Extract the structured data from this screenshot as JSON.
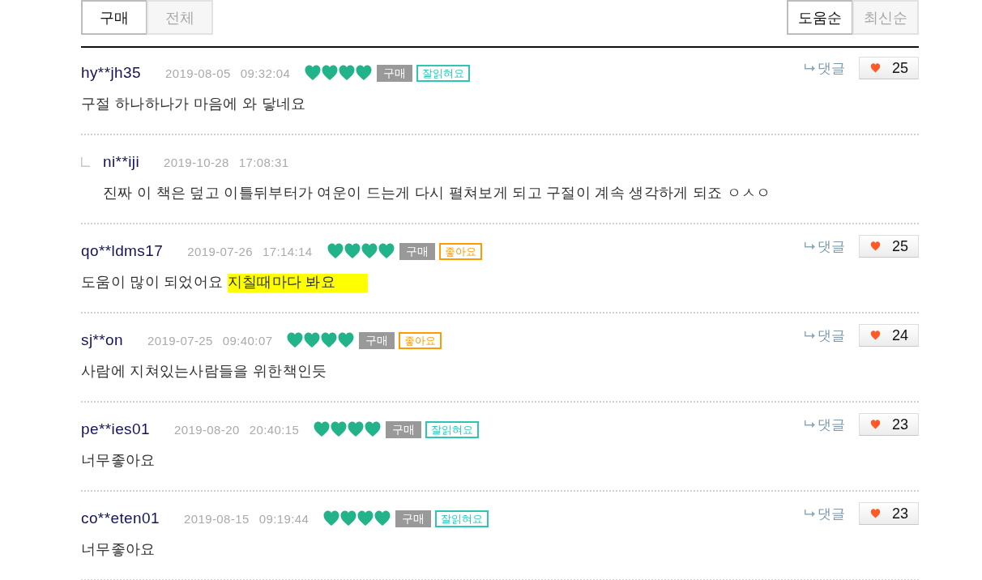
{
  "filter_tabs": [
    {
      "label": "구매",
      "selected": true
    },
    {
      "label": "전체",
      "selected": false
    }
  ],
  "sort_tabs": [
    {
      "label": "도움순",
      "selected": true
    },
    {
      "label": "최신순",
      "selected": false
    }
  ],
  "reviews": [
    {
      "user": "hy**jh35",
      "date": "2019-08-05",
      "time": "09:32:04",
      "stars": 4,
      "badge": "구매",
      "tag": {
        "label": "잘읽혀요",
        "color": "#2ec4b6"
      },
      "text": "구절 하나하나가 마음에 와 닿네요",
      "reply_link": "댓글",
      "likes": "25",
      "replies": [
        {
          "user": "ni**iji",
          "date": "2019-10-28",
          "time": "17:08:31",
          "text": "진짜 이 책은 덮고 이틀뒤부터가 여운이 드는게 다시 펼쳐보게 되고 구절이 계속 생각하게 되죠 ㅇㅅㅇ"
        }
      ]
    },
    {
      "user": "qo**ldms17",
      "date": "2019-07-26",
      "time": "17:14:14",
      "stars": 4,
      "badge": "구매",
      "tag": {
        "label": "좋아요",
        "color": "#ff9a00"
      },
      "text": "도움이 많이 되었어요",
      "highlight": "지칠때마다 봐요",
      "reply_link": "댓글",
      "likes": "25"
    },
    {
      "user": "sj**on",
      "date": "2019-07-25",
      "time": "09:40:07",
      "stars": 4,
      "badge": "구매",
      "tag": {
        "label": "좋아요",
        "color": "#ff9a00"
      },
      "text": "사람에 지쳐있는사람들을 위한책인듯",
      "reply_link": "댓글",
      "likes": "24"
    },
    {
      "user": "pe**ies01",
      "date": "2019-08-20",
      "time": "20:40:15",
      "stars": 4,
      "badge": "구매",
      "tag": {
        "label": "잘읽혀요",
        "color": "#2ec4b6"
      },
      "text": "너무좋아요",
      "reply_link": "댓글",
      "likes": "23"
    },
    {
      "user": "co**eten01",
      "date": "2019-08-15",
      "time": "09:19:44",
      "stars": 4,
      "badge": "구매",
      "tag": {
        "label": "잘읽혀요",
        "color": "#2ec4b6"
      },
      "text": "너무좋아요",
      "reply_link": "댓글",
      "likes": "23"
    }
  ]
}
